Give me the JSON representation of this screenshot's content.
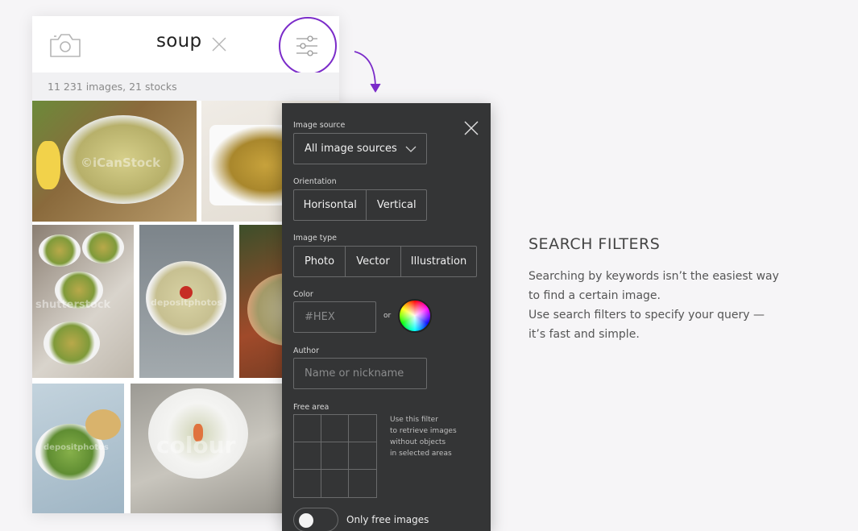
{
  "search": {
    "query": "soup",
    "result_count": "11 231 images, 21 stocks"
  },
  "watermarks": [
    "©iCanStock",
    "shutterstock",
    "depositphotos",
    "depositphotos",
    "colour"
  ],
  "filters": {
    "image_source": {
      "label": "Image source",
      "value": "All image sources"
    },
    "orientation": {
      "label": "Orientation",
      "options": [
        "Horisontal",
        "Vertical"
      ]
    },
    "image_type": {
      "label": "Image type",
      "options": [
        "Photo",
        "Vector",
        "Illustration"
      ]
    },
    "color": {
      "label": "Color",
      "placeholder": "#HEX",
      "or_label": "or"
    },
    "author": {
      "label": "Author",
      "placeholder": "Name or nickname"
    },
    "free_area": {
      "label": "Free area",
      "hint_lines": [
        "Use this filter",
        "to retrieve images",
        "without objects",
        "in selected areas"
      ]
    },
    "only_free": {
      "label": "Only free images",
      "enabled": false
    }
  },
  "feature": {
    "heading": "SEARCH FILTERS",
    "lines": [
      "Searching by keywords isn’t the easiest way",
      "to find a certain image.",
      "Use search filters to specify your query —",
      "it’s fast and simple."
    ]
  },
  "colors": {
    "accent": "#7b2cc9",
    "panel_bg": "#343536",
    "page_bg": "#f6f5f7"
  },
  "icons": [
    "camera-icon",
    "close-icon",
    "filter-sliders-icon",
    "chevron-down-icon",
    "color-wheel-icon",
    "curved-arrow-icon"
  ]
}
